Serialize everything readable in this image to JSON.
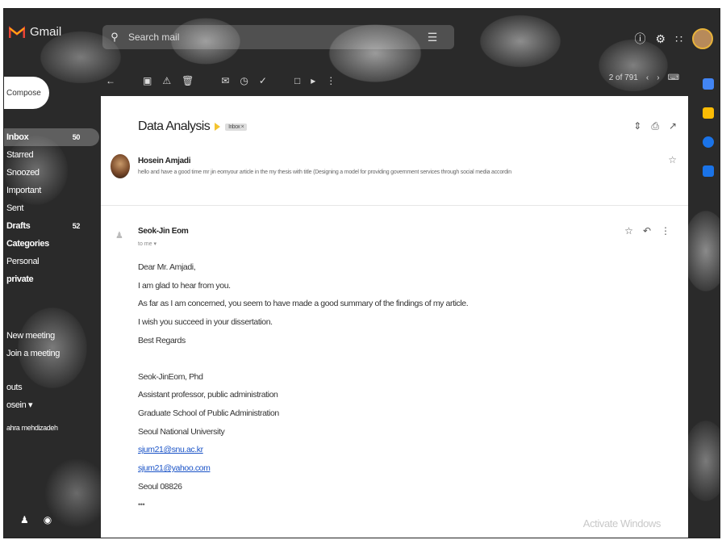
{
  "app": {
    "name": "Gmail",
    "brand_color": "#EA4335"
  },
  "search": {
    "placeholder": "Search mail",
    "icon": "search-icon"
  },
  "toolbar": {
    "pager": "2 of 791"
  },
  "compose": {
    "label": "Compose"
  },
  "sidebar": {
    "items": [
      {
        "label": "Inbox",
        "count": "50",
        "bold": true,
        "active": true
      },
      {
        "label": "Starred",
        "bold": false
      },
      {
        "label": "Snoozed",
        "bold": false
      },
      {
        "label": "Important",
        "bold": false
      },
      {
        "label": "Sent",
        "bold": false
      },
      {
        "label": "Drafts",
        "count": "52",
        "bold": true
      },
      {
        "label": "Categories",
        "bold": true
      },
      {
        "label": "Personal",
        "bold": false
      },
      {
        "label": "private",
        "bold": true
      }
    ],
    "meet": {
      "new_meeting": "New meeting",
      "join_meeting": "Join a meeting"
    },
    "hangouts": {
      "header": "outs",
      "user": "osein",
      "contact": "ahra mehdizadeh"
    }
  },
  "thread": {
    "subject": "Data Analysis",
    "label": "Inbox",
    "messages": [
      {
        "sender": "Hosein Amjadi",
        "snippet": "hello and have a good time mr jin eomyour article in the my thesis with title (Designing a model for providing government services through social media accordin"
      },
      {
        "sender": "Seok-Jin Eom",
        "to": "to me",
        "body": {
          "greeting": "Dear Mr. Amjadi,",
          "line1": "I am glad to hear from you.",
          "line2": "As far as I am concerned, you seem to have made a good summary of the findings of my article.",
          "line3": "I wish you succeed in your dissertation.",
          "closing": "Best Regards"
        },
        "signature": {
          "name": "Seok-JinEom, Phd",
          "title": "Assistant professor, public administration",
          "school": "Graduate School of Public Administration",
          "university": "Seoul National University",
          "email1": "sjum21@snu.ac.kr",
          "email2": "sjum21@yahoo.com",
          "address": "Seoul 08826"
        },
        "ellipsis": "•••"
      }
    ]
  },
  "watermark": "Activate Windows"
}
